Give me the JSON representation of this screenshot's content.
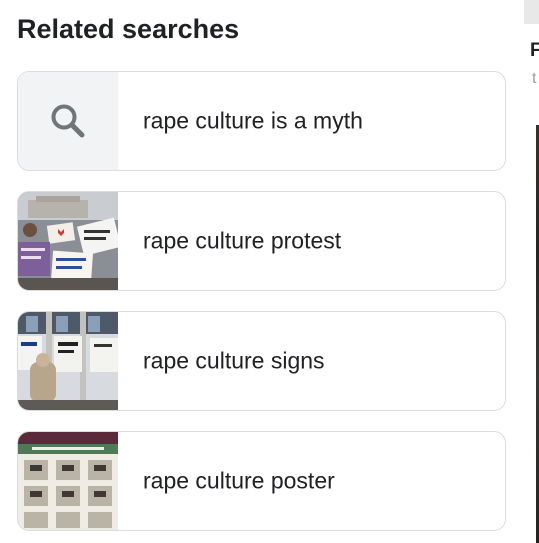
{
  "section": {
    "title": "Related searches"
  },
  "related": [
    {
      "label": "rape culture is a myth",
      "thumb": "search-icon"
    },
    {
      "label": "rape culture protest",
      "thumb": "protest-photo"
    },
    {
      "label": "rape culture signs",
      "thumb": "signs-photo"
    },
    {
      "label": "rape culture poster",
      "thumb": "poster-image"
    }
  ],
  "right_column": {
    "heading_fragment": "F",
    "subtext_fragment": "t"
  },
  "colors": {
    "text": "#202124",
    "border": "#dadce0",
    "search_thumb_bg": "#f1f3f4",
    "icon": "#70757a"
  }
}
